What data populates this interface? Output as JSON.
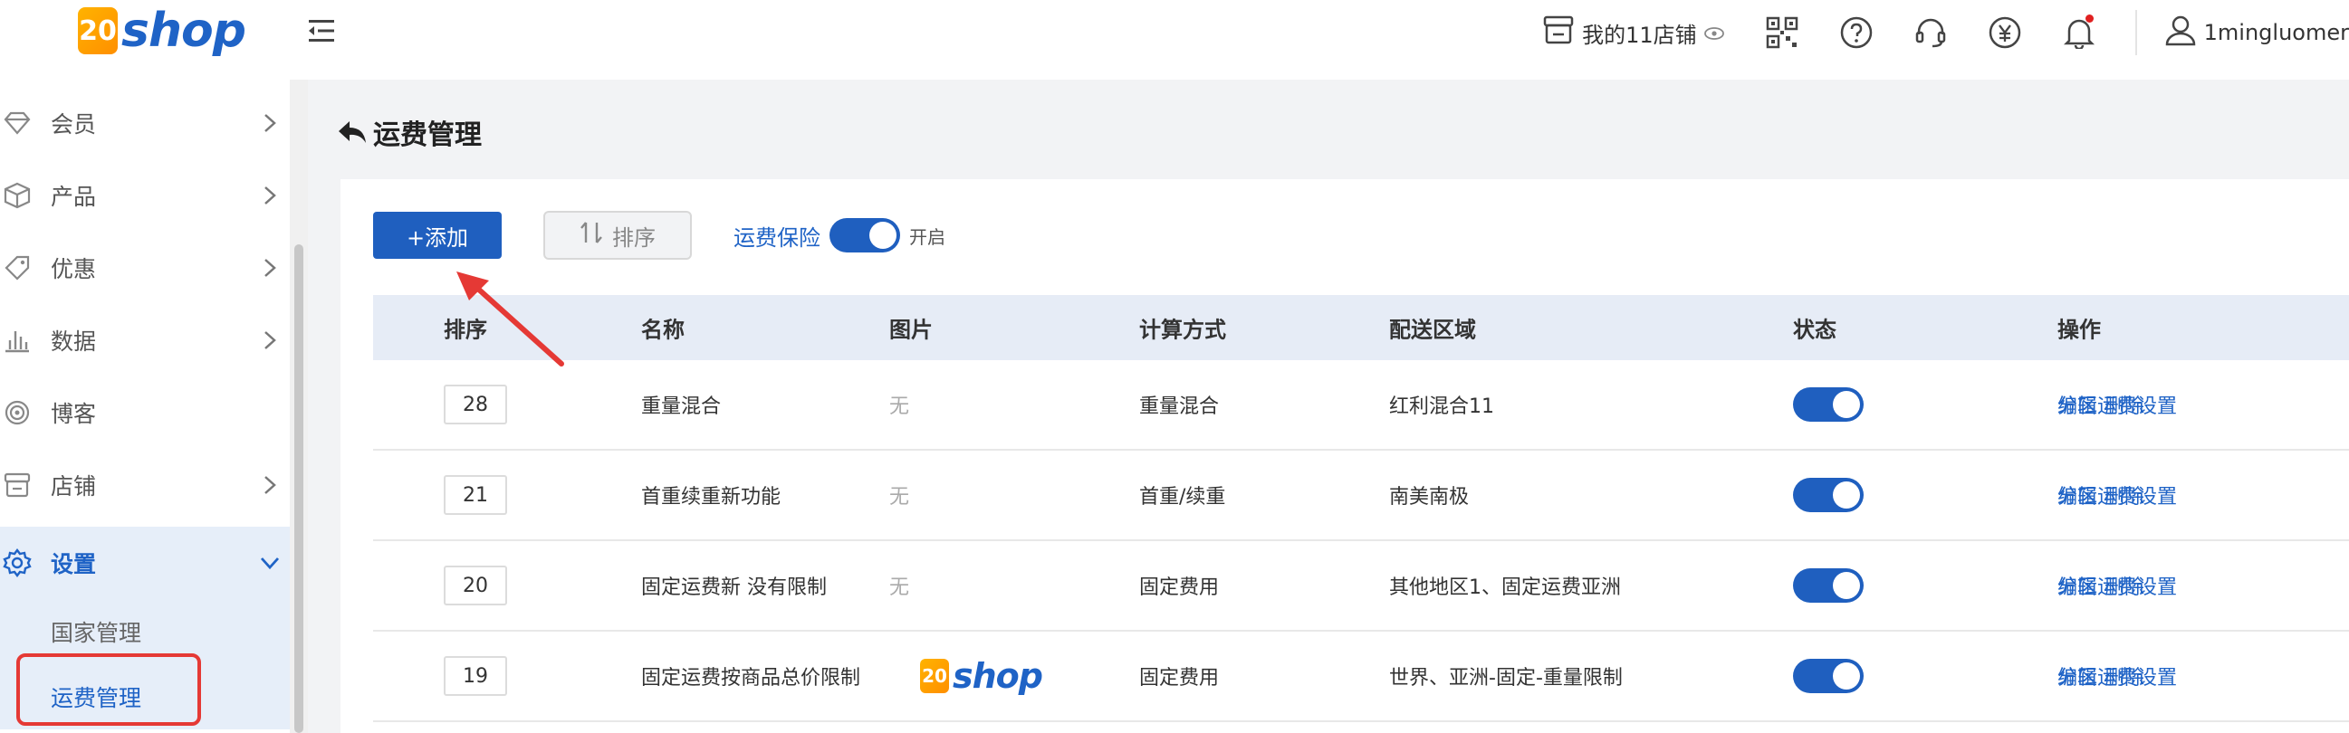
{
  "header": {
    "brand_badge": "20",
    "brand_text": "shop",
    "store_label": "我的11店铺",
    "username": "1mingluomer",
    "icons": [
      "qrcode-icon",
      "help-icon",
      "headset-icon",
      "yen-icon",
      "bell-icon",
      "user-icon"
    ]
  },
  "sidebar": {
    "items": [
      {
        "label": "会员",
        "icon": "diamond-icon"
      },
      {
        "label": "产品",
        "icon": "box-icon"
      },
      {
        "label": "优惠",
        "icon": "tag-icon"
      },
      {
        "label": "数据",
        "icon": "bar-chart-icon"
      },
      {
        "label": "博客",
        "icon": "blog-icon"
      },
      {
        "label": "店铺",
        "icon": "store-icon"
      },
      {
        "label": "设置",
        "icon": "gear-icon"
      }
    ],
    "sub_items": [
      {
        "label": "国家管理"
      },
      {
        "label": "运费管理"
      }
    ]
  },
  "page": {
    "title": "运费管理"
  },
  "toolbar": {
    "add_label": "+添加",
    "sort_label": "排序",
    "insurance_label": "运费保险",
    "insurance_state": "开启"
  },
  "table": {
    "columns": [
      "排序",
      "名称",
      "图片",
      "计算方式",
      "配送区域",
      "状态",
      "操作"
    ],
    "rows": [
      {
        "order": "28",
        "name": "重量混合",
        "image": "无",
        "calc": "重量混合",
        "area": "红利混合11",
        "enabled": true
      },
      {
        "order": "21",
        "name": "首重续重新功能",
        "image": "无",
        "calc": "首重/续重",
        "area": "南美南极",
        "enabled": true
      },
      {
        "order": "20",
        "name": "固定运费新 没有限制",
        "image": "无",
        "calc": "固定费用",
        "area": "其他地区1、固定运费亚洲",
        "enabled": true
      },
      {
        "order": "19",
        "name": "固定运费按商品总价限制",
        "image": "",
        "calc": "固定费用",
        "area": "世界、亚洲-固定-重量限制",
        "enabled": true
      }
    ],
    "row_image_logo": {
      "badge": "20",
      "text": "shop"
    },
    "ops": {
      "zone": "分区运费设置",
      "edit": "编辑",
      "delete": "删除"
    }
  },
  "colors": {
    "primary": "#1f5fbf",
    "link": "#1f63c6",
    "annotation": "#e53935",
    "header_bg": "#e6ecf6",
    "sidebar_active_bg": "#e6eef9"
  }
}
